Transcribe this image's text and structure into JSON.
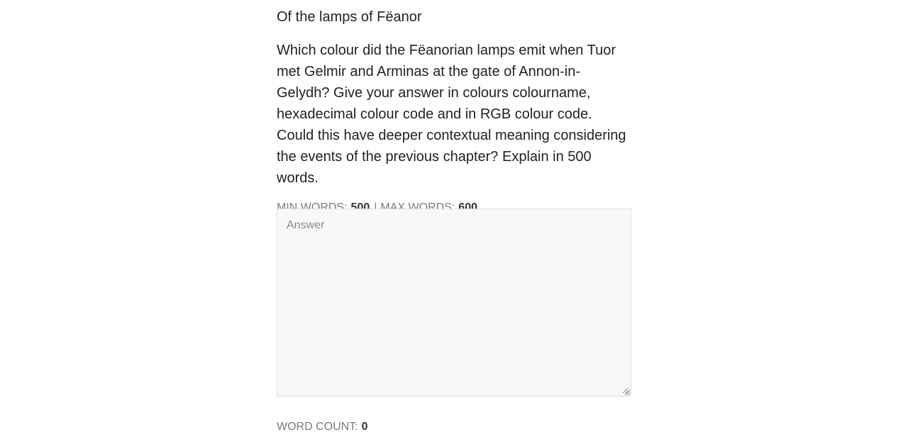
{
  "question": {
    "title": "Of the lamps of Fëanor",
    "prompt": "Which colour did the Fëanorian lamps emit when Tuor met Gelmir and Arminas at the gate of Annon-in-Gelydh? Give your answer in colours colourname, hexadecimal colour code and in RGB colour code. Could this have deeper contextual meaning considering the events of the previous chapter? Explain in 500 words."
  },
  "limits": {
    "min_label": "Min words:",
    "min_value": "500",
    "separator": "|",
    "max_label": "Max words:",
    "max_value": "600"
  },
  "answer": {
    "value": "",
    "placeholder": "Answer"
  },
  "word_count": {
    "label": "Word count:",
    "value": "0"
  },
  "icons": {
    "resize": "resize-grip-icon"
  },
  "colors": {
    "text": "#222222",
    "muted": "#7a7a7a",
    "field_bg": "#f8f8f8",
    "field_border": "#dddddd"
  }
}
